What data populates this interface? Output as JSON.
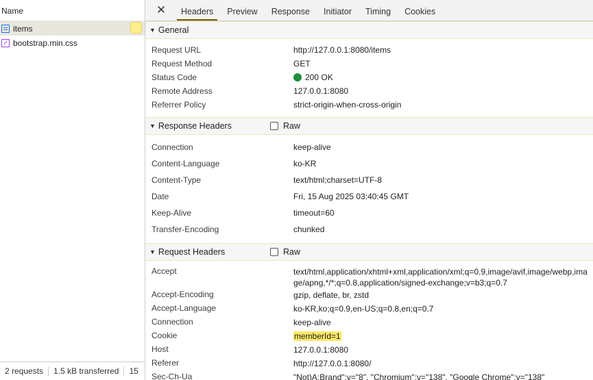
{
  "left": {
    "column_header": "Name",
    "requests": [
      {
        "name": "items",
        "type": "document",
        "selected": true
      },
      {
        "name": "bootstrap.min.css",
        "type": "stylesheet",
        "selected": false
      }
    ],
    "footer": {
      "requests": "2 requests",
      "transferred": "1.5 kB transferred",
      "cut": "15"
    }
  },
  "tabs": [
    "Headers",
    "Preview",
    "Response",
    "Initiator",
    "Timing",
    "Cookies"
  ],
  "active_tab": "Headers",
  "close_glyph": "✕",
  "general": {
    "title": "General",
    "rows": [
      {
        "key": "Request URL",
        "value": "http://127.0.0.1:8080/items"
      },
      {
        "key": "Request Method",
        "value": "GET"
      },
      {
        "key": "Status Code",
        "value": "200 OK"
      },
      {
        "key": "Remote Address",
        "value": "127.0.0.1:8080"
      },
      {
        "key": "Referrer Policy",
        "value": "strict-origin-when-cross-origin"
      }
    ]
  },
  "response_headers": {
    "title": "Response Headers",
    "raw_label": "Raw",
    "rows": [
      {
        "key": "Connection",
        "value": "keep-alive"
      },
      {
        "key": "Content-Language",
        "value": "ko-KR"
      },
      {
        "key": "Content-Type",
        "value": "text/html;charset=UTF-8"
      },
      {
        "key": "Date",
        "value": "Fri, 15 Aug 2025 03:40:45 GMT"
      },
      {
        "key": "Keep-Alive",
        "value": "timeout=60"
      },
      {
        "key": "Transfer-Encoding",
        "value": "chunked"
      }
    ]
  },
  "request_headers": {
    "title": "Request Headers",
    "raw_label": "Raw",
    "rows": [
      {
        "key": "Accept",
        "value": "text/html,application/xhtml+xml,application/xml;q=0.9,image/avif,image/webp,image/apng,*/*;q=0.8,application/signed-exchange;v=b3;q=0.7"
      },
      {
        "key": "Accept-Encoding",
        "value": "gzip, deflate, br, zstd"
      },
      {
        "key": "Accept-Language",
        "value": "ko-KR,ko;q=0.9,en-US;q=0.8,en;q=0.7"
      },
      {
        "key": "Connection",
        "value": "keep-alive"
      },
      {
        "key": "Cookie",
        "value": "memberId=1"
      },
      {
        "key": "Host",
        "value": "127.0.0.1:8080"
      },
      {
        "key": "Referer",
        "value": "http://127.0.0.1:8080/"
      },
      {
        "key": "Sec-Ch-Ua",
        "value": "\"Not)A;Brand\";v=\"8\", \"Chromium\";v=\"138\", \"Google Chrome\";v=\"138\""
      }
    ]
  },
  "colors": {
    "status_ok": "#1e8e3e",
    "cookie_highlight": "#fbe968",
    "active_tab_underline": "#7a5b00"
  },
  "icons": {
    "document": "document-icon",
    "stylesheet": "stylesheet-icon",
    "close": "close-icon",
    "collapse": "triangle-down-icon"
  }
}
